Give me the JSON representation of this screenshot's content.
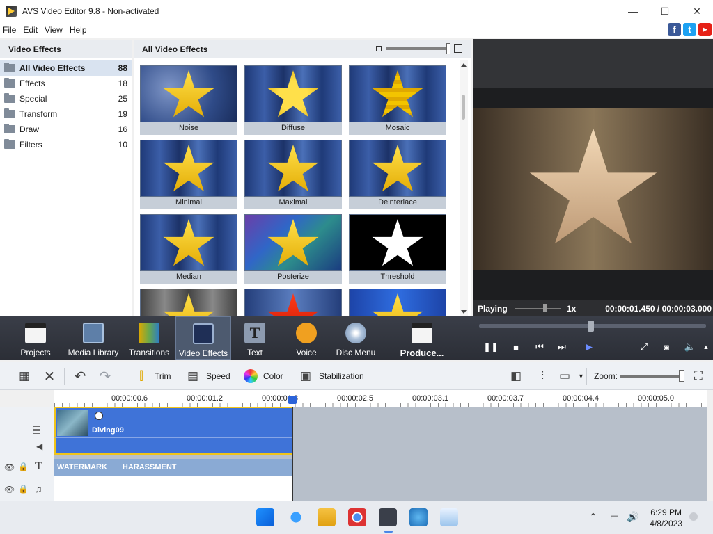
{
  "window": {
    "title": "AVS Video Editor 9.8 - Non-activated",
    "minimize": "—",
    "maximize": "☐",
    "close": "✕"
  },
  "menu": [
    "File",
    "Edit",
    "View",
    "Help"
  ],
  "social": {
    "facebook": "f",
    "twitter": "t",
    "youtube": "▶"
  },
  "left_panel": {
    "title": "Video Effects",
    "categories": [
      {
        "label": "All Video Effects",
        "count": "88"
      },
      {
        "label": "Effects",
        "count": "18"
      },
      {
        "label": "Special",
        "count": "25"
      },
      {
        "label": "Transform",
        "count": "19"
      },
      {
        "label": "Draw",
        "count": "16"
      },
      {
        "label": "Filters",
        "count": "10"
      }
    ]
  },
  "effects_panel": {
    "title": "All Video Effects",
    "tiles": [
      "Noise",
      "Diffuse",
      "Mosaic",
      "Minimal",
      "Maximal",
      "Deinterlace",
      "Median",
      "Posterize",
      "Threshold"
    ]
  },
  "preview": {
    "status": "Playing",
    "speed": "1x",
    "time": "00:00:01.450 / 00:00:03.000"
  },
  "main_toolbar": {
    "projects": "Projects",
    "media_library": "Media Library",
    "transitions": "Transitions",
    "video_effects": "Video Effects",
    "text": "Text",
    "voice": "Voice",
    "disc_menu": "Disc Menu",
    "produce": "Produce..."
  },
  "edit_toolbar": {
    "trim": "Trim",
    "speed": "Speed",
    "color": "Color",
    "stabilization": "Stabilization",
    "zoom": "Zoom:"
  },
  "timeline": {
    "ticks": [
      "00:00:00.6",
      "00:00:01.2",
      "00:00:01.8",
      "00:00:02.5",
      "00:00:03.1",
      "00:00:03.7",
      "00:00:04.4",
      "00:00:05.0"
    ],
    "video_clip": "Diving09",
    "text_clip": [
      "WATERMARK",
      "HARASSMENT"
    ]
  },
  "taskbar": {
    "time": "6:29 PM",
    "date": "4/8/2023"
  }
}
